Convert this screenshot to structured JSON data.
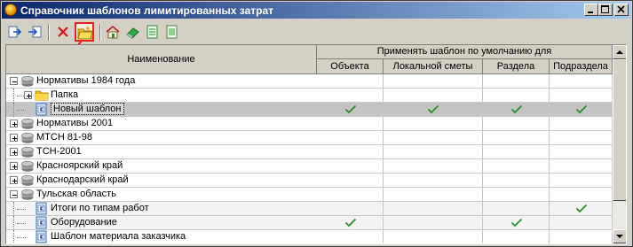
{
  "window": {
    "title": "Справочник шаблонов лимитированных затрат"
  },
  "header": {
    "name_col": "Наименование",
    "group_col": "Применять шаблон по умолчанию для",
    "sub_cols": [
      "Объекта",
      "Локальной сметы",
      "Раздела",
      "Подраздела"
    ]
  },
  "rows": [
    {
      "label": "Нормативы 1984 года",
      "level": 0,
      "icon": "database-icon",
      "expander": "minus",
      "checks": [
        false,
        false,
        false,
        false
      ],
      "state": ""
    },
    {
      "label": "Папка",
      "level": 1,
      "icon": "folder-icon",
      "expander": "plus",
      "checks": [
        false,
        false,
        false,
        false
      ],
      "state": ""
    },
    {
      "label": "Новый шаблон",
      "level": 1,
      "icon": "template-icon",
      "expander": "none",
      "checks": [
        true,
        true,
        true,
        true
      ],
      "state": "selected"
    },
    {
      "label": "Нормативы 2001",
      "level": 0,
      "icon": "database-icon",
      "expander": "plus",
      "checks": [
        false,
        false,
        false,
        false
      ],
      "state": ""
    },
    {
      "label": "МТСН 81-98",
      "level": 0,
      "icon": "database-icon",
      "expander": "plus",
      "checks": [
        false,
        false,
        false,
        false
      ],
      "state": ""
    },
    {
      "label": "ТСН-2001",
      "level": 0,
      "icon": "database-icon",
      "expander": "plus",
      "checks": [
        false,
        false,
        false,
        false
      ],
      "state": ""
    },
    {
      "label": "Красноярский край",
      "level": 0,
      "icon": "database-icon",
      "expander": "plus",
      "checks": [
        false,
        false,
        false,
        false
      ],
      "state": ""
    },
    {
      "label": "Краснодарский край",
      "level": 0,
      "icon": "database-icon",
      "expander": "plus",
      "checks": [
        false,
        false,
        false,
        false
      ],
      "state": ""
    },
    {
      "label": "Тульская область",
      "level": 0,
      "icon": "database-icon",
      "expander": "minus",
      "checks": [
        false,
        false,
        false,
        false
      ],
      "state": ""
    },
    {
      "label": "Итоги по типам работ",
      "level": 1,
      "icon": "template-icon",
      "expander": "none",
      "checks": [
        false,
        false,
        false,
        true
      ],
      "state": "alt"
    },
    {
      "label": "Оборудование",
      "level": 1,
      "icon": "template-icon",
      "expander": "none",
      "checks": [
        true,
        false,
        true,
        false
      ],
      "state": "alt"
    },
    {
      "label": "Шаблон материала заказчика",
      "level": 1,
      "icon": "template-icon",
      "expander": "none",
      "checks": [
        false,
        false,
        false,
        false
      ],
      "state": ""
    }
  ],
  "toolbar": {
    "buttons": [
      {
        "name": "export-icon-button",
        "icon": "export-icon"
      },
      {
        "name": "import-icon-button",
        "icon": "import-icon"
      },
      {
        "name": "delete-button",
        "icon": "delete-icon"
      },
      {
        "name": "new-folder-button",
        "icon": "new-folder-icon"
      },
      {
        "name": "home-button",
        "icon": "home-icon"
      },
      {
        "name": "book-button",
        "icon": "book-icon"
      },
      {
        "name": "sheet-button",
        "icon": "sheet-icon"
      },
      {
        "name": "sheet-alt-button",
        "icon": "sheet-alt-icon"
      }
    ]
  },
  "colors": {
    "check": "#2e8b2e",
    "annotation": "#e02020",
    "title_start": "#0a246a",
    "title_end": "#a6caf0"
  }
}
